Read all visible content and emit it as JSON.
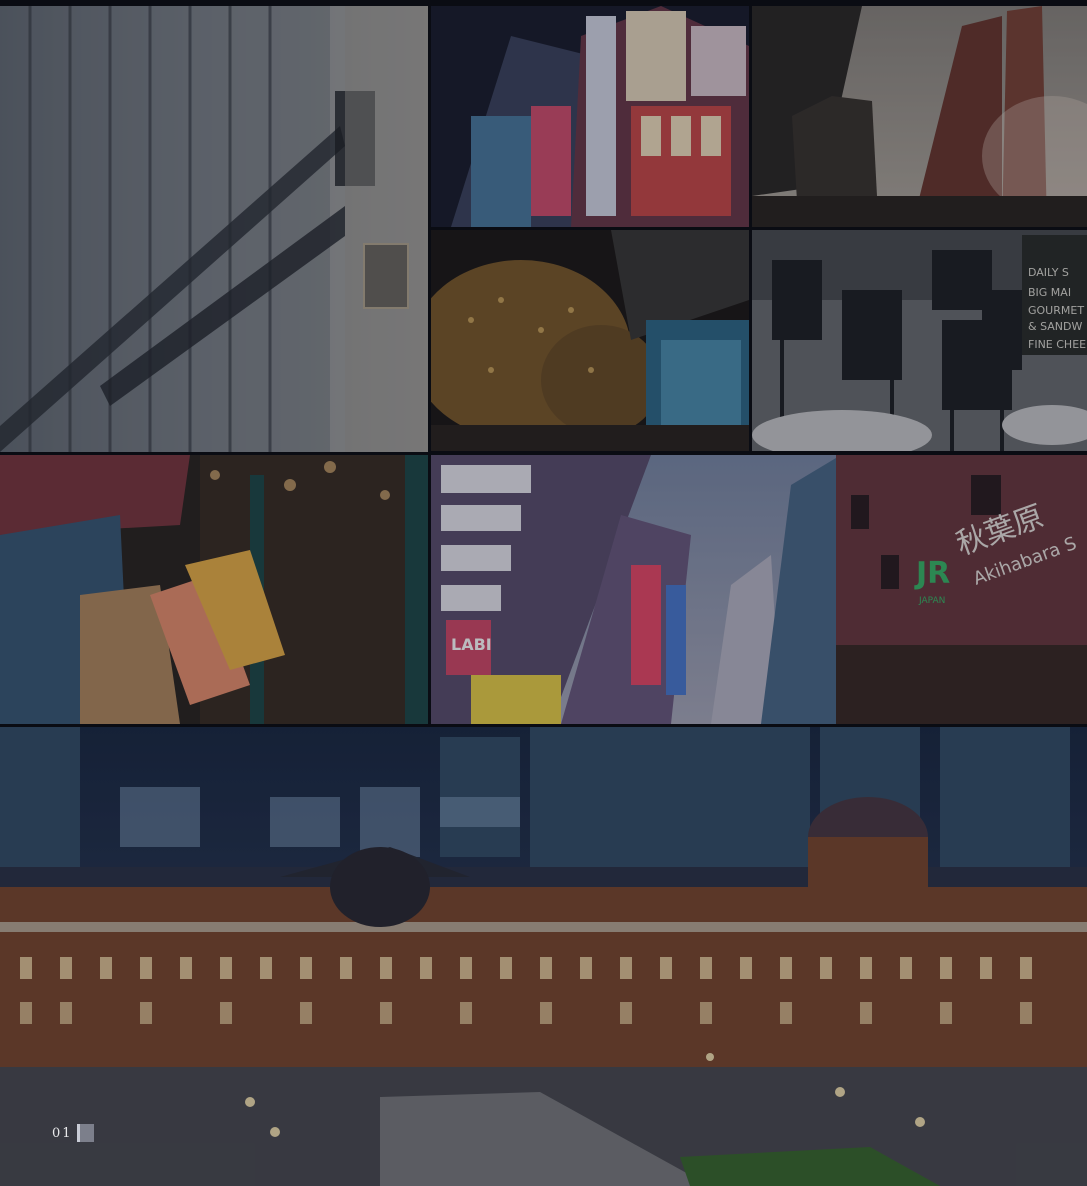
{
  "collage": {
    "tiles": [
      {
        "subject": "department-store-facade"
      },
      {
        "subject": "akihabara-billboards"
      },
      {
        "subject": "twin-tower-skyscraper"
      },
      {
        "subject": "illuminated-trees-plaza"
      },
      {
        "subject": "outdoor-cafe-chalkboard"
      },
      {
        "subject": "shopping-bags"
      },
      {
        "subject": "akihabara-street-and-station"
      },
      {
        "subject": "tokyo-station-at-night"
      }
    ],
    "cafe_board_text": [
      "DAILY S",
      "BIG MAI",
      "GOURMET",
      "& SANDW",
      "FINE CHEE"
    ],
    "station_sign_kanji": "秋葉原",
    "station_sign_latin": "Akihabara S",
    "station_logo": "JR",
    "station_logo_sub": "JAPAN",
    "labi_sign": "LABI"
  },
  "slide_counter": {
    "value": "01"
  }
}
